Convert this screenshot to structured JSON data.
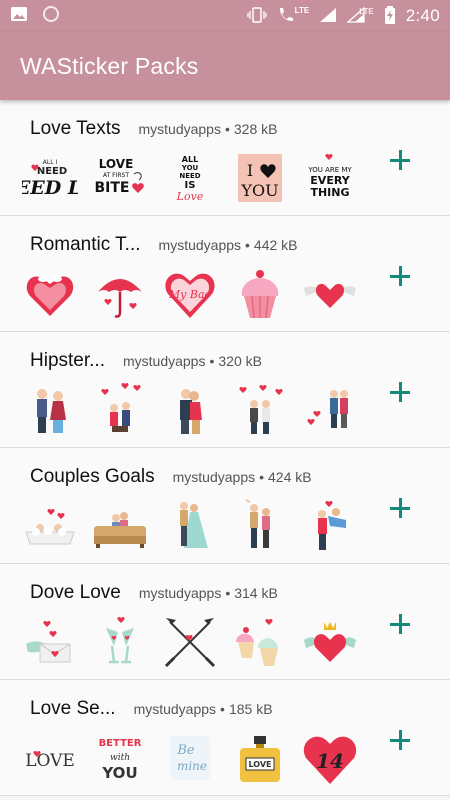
{
  "status_bar": {
    "network": "LTE",
    "network2": "LTE",
    "time": "2:40"
  },
  "app_bar": {
    "title": "WASticker Packs"
  },
  "packs": [
    {
      "name": "Love Texts",
      "publisher": "mystudyapps",
      "separator": "•",
      "size": "328 kB",
      "stickers": [
        {
          "icon": "i-need-love-text-sticker",
          "text": "I NEED Love"
        },
        {
          "icon": "love-at-first-bite-text-sticker",
          "text": "LOVE AT FIRST BITE"
        },
        {
          "icon": "all-you-need-is-love-text-sticker",
          "text": "ALL YOU NEED IS Love"
        },
        {
          "icon": "i-heart-you-text-sticker",
          "text": "I YOU"
        },
        {
          "icon": "you-are-my-every-thing-text-sticker",
          "text": "YOU ARE MY EVERY THING"
        }
      ]
    },
    {
      "name": "Romantic T...",
      "publisher": "mystudyapps",
      "separator": "•",
      "size": "442 kB",
      "stickers": [
        {
          "icon": "heart-with-birds-sticker"
        },
        {
          "icon": "umbrella-hearts-sticker"
        },
        {
          "icon": "my-bae-heart-sticker",
          "text": "My Bae"
        },
        {
          "icon": "cupcake-sticker"
        },
        {
          "icon": "winged-heart-sticker"
        }
      ]
    },
    {
      "name": "Hipster...",
      "publisher": "mystudyapps",
      "separator": "•",
      "size": "320 kB",
      "stickers": [
        {
          "icon": "hipster-couple-sticker"
        },
        {
          "icon": "couple-balloons-sticker"
        },
        {
          "icon": "hipster-couple-hug-sticker"
        },
        {
          "icon": "couple-hearts-sticker"
        },
        {
          "icon": "couple-heart-balloons-sticker"
        }
      ]
    },
    {
      "name": "Couples Goals",
      "publisher": "mystudyapps",
      "separator": "•",
      "size": "424 kB",
      "stickers": [
        {
          "icon": "couple-bathtub-sticker"
        },
        {
          "icon": "couple-sofa-sticker"
        },
        {
          "icon": "couple-dancing-sticker"
        },
        {
          "icon": "couple-standing-sticker"
        },
        {
          "icon": "couple-carry-sticker"
        }
      ]
    },
    {
      "name": "Dove Love",
      "publisher": "mystudyapps",
      "separator": "•",
      "size": "314 kB",
      "stickers": [
        {
          "icon": "love-letter-sticker"
        },
        {
          "icon": "champagne-glasses-sticker"
        },
        {
          "icon": "crossed-arrows-sticker"
        },
        {
          "icon": "cupcakes-sticker"
        },
        {
          "icon": "crowned-winged-heart-sticker"
        }
      ]
    },
    {
      "name": "Love Se...",
      "publisher": "mystudyapps",
      "separator": "•",
      "size": "185 kB",
      "stickers": [
        {
          "icon": "love-lettering-sticker",
          "text": "LOVE"
        },
        {
          "icon": "better-with-you-sticker",
          "text": "BETTER with YOU"
        },
        {
          "icon": "be-mine-sticker",
          "text": "Be mine"
        },
        {
          "icon": "perfume-love-sticker",
          "text": "LOVE"
        },
        {
          "icon": "heart-14-sticker",
          "text": "14"
        }
      ]
    }
  ],
  "colors": {
    "app_bar": "#c6919c",
    "add_button": "#138a7a",
    "heart": "#e8334f"
  }
}
